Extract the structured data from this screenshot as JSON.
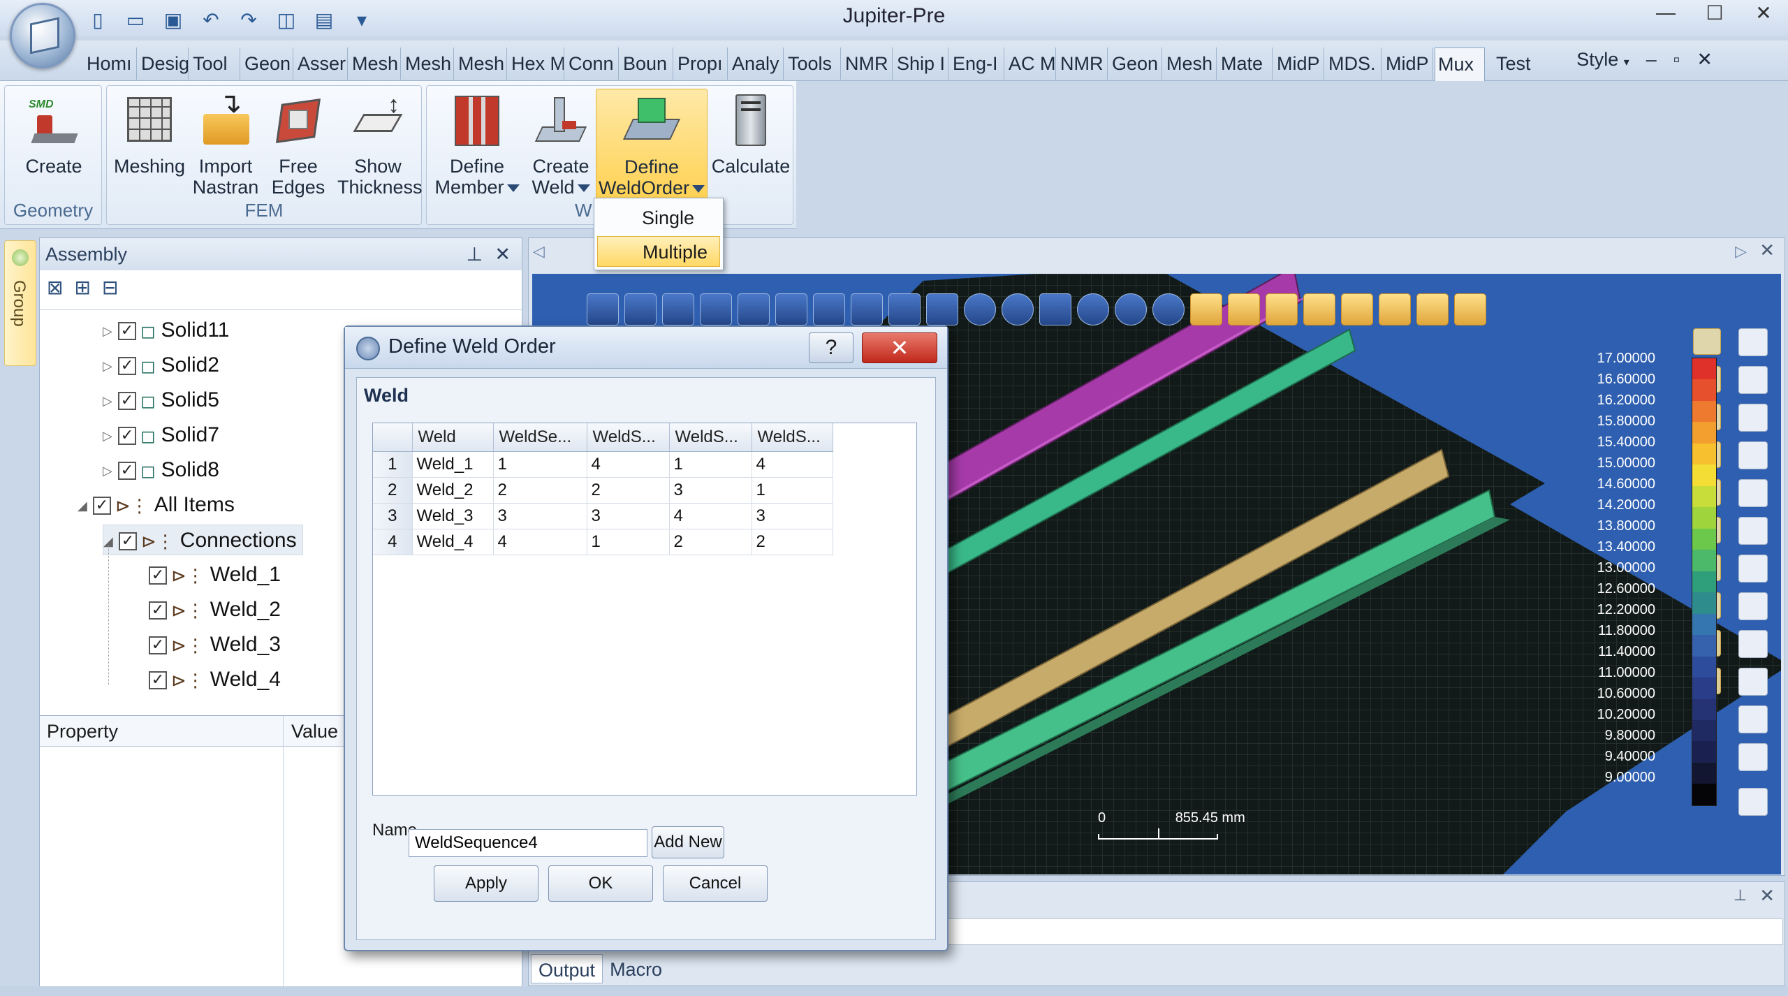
{
  "window": {
    "title": "Jupiter-Pre"
  },
  "ribbon_tabs": [
    "Homı",
    "Desig",
    "Tool",
    "Geon",
    "Asser",
    "Mesh",
    "Mesh",
    "Mesh",
    "Hex M",
    "Conn",
    "Boun",
    "Propı",
    "Analy",
    "Tools",
    "NMR",
    "Ship I",
    "Eng-I",
    "AC M",
    "NMR",
    "Geon",
    "Mesh",
    "Mate",
    "MidP",
    "MDS.",
    "MidP",
    "Mux",
    "Test"
  ],
  "active_tab": "Mux",
  "style_menu": "Style",
  "ribbon": {
    "groups": [
      {
        "label": "Geometry",
        "buttons": [
          {
            "label": "Create",
            "badge": "SMD"
          }
        ]
      },
      {
        "label": "FEM",
        "buttons": [
          {
            "label": "Meshing"
          },
          {
            "label": "Import Nastran"
          },
          {
            "label": "Free Edges"
          },
          {
            "label": "Show Thickness"
          }
        ]
      },
      {
        "label": "W",
        "buttons": [
          {
            "label": "Define Member"
          },
          {
            "label": "Create Weld"
          },
          {
            "label": "Define WeldOrder"
          },
          {
            "label": "Calculate"
          }
        ]
      }
    ]
  },
  "dropdown": {
    "items": [
      "Single",
      "Multiple"
    ],
    "highlighted": "Multiple"
  },
  "left_strip": {
    "label": "Group"
  },
  "assembly": {
    "title": "Assembly",
    "tree": [
      {
        "label": "Solid11",
        "level": 2
      },
      {
        "label": "Solid2",
        "level": 2
      },
      {
        "label": "Solid5",
        "level": 2
      },
      {
        "label": "Solid7",
        "level": 2
      },
      {
        "label": "Solid8",
        "level": 2
      },
      {
        "label": "All Items",
        "level": 1
      },
      {
        "label": "Connections",
        "level": 2
      },
      {
        "label": "Weld_1",
        "level": 3
      },
      {
        "label": "Weld_2",
        "level": 3
      },
      {
        "label": "Weld_3",
        "level": 3
      },
      {
        "label": "Weld_4",
        "level": 3
      }
    ]
  },
  "property_panel": {
    "col1": "Property",
    "col2": "Value"
  },
  "dialog": {
    "title": "Define Weld Order",
    "group_label": "Weld",
    "columns": [
      "Weld",
      "WeldSe...",
      "WeldS...",
      "WeldS...",
      "WeldS..."
    ],
    "rows": [
      {
        "n": "1",
        "cells": [
          "Weld_1",
          "1",
          "4",
          "1",
          "4"
        ]
      },
      {
        "n": "2",
        "cells": [
          "Weld_2",
          "2",
          "2",
          "3",
          "1"
        ]
      },
      {
        "n": "3",
        "cells": [
          "Weld_3",
          "3",
          "3",
          "4",
          "3"
        ]
      },
      {
        "n": "4",
        "cells": [
          "Weld_4",
          "4",
          "1",
          "2",
          "2"
        ]
      }
    ],
    "name_label": "Name",
    "name_value": "WeldSequence4",
    "add_new": "Add New",
    "apply": "Apply",
    "ok": "OK",
    "cancel": "Cancel",
    "help": "?"
  },
  "legend": {
    "values": [
      "17.00000",
      "16.60000",
      "16.20000",
      "15.80000",
      "15.40000",
      "15.00000",
      "14.60000",
      "14.20000",
      "13.80000",
      "13.40000",
      "13.00000",
      "12.60000",
      "12.20000",
      "11.80000",
      "11.40000",
      "11.00000",
      "10.60000",
      "10.20000",
      "9.80000",
      "9.40000",
      "9.00000"
    ],
    "colors": [
      "#e0302a",
      "#e6502c",
      "#ed7a2e",
      "#f29f2f",
      "#f7c02f",
      "#f4de35",
      "#c9dd3a",
      "#9fd43d",
      "#6bc84a",
      "#4cb86a",
      "#2f9e7a",
      "#2e8c8d",
      "#3576b0",
      "#3561ad",
      "#2e4c9c",
      "#2a3d88",
      "#253374",
      "#1f2a62",
      "#1a2151",
      "#121630",
      "#050508"
    ]
  },
  "scale": {
    "zero": "0",
    "length": "855.45 mm"
  },
  "output_tabs": [
    "Output",
    "Macro"
  ],
  "colors": {
    "weld_magenta": "#a53aa8",
    "weld_green": "#39b98a",
    "weld_tan": "#c7ab6a",
    "weld_green2": "#46c08a",
    "plate": "#111a18",
    "viewport_bg": "#2f5fb0"
  }
}
